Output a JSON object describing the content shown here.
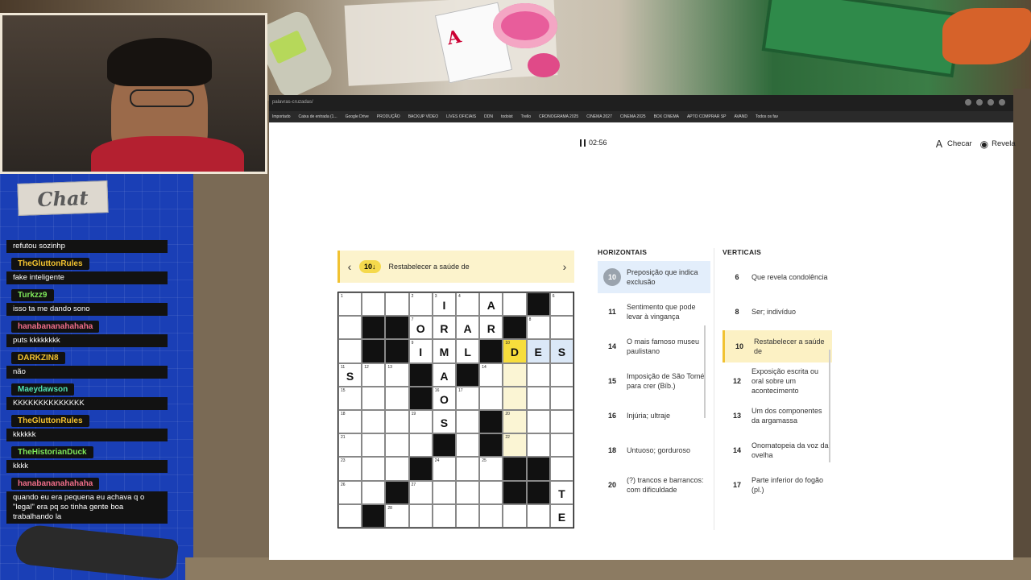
{
  "browser": {
    "url": "palavras-cruzadas/",
    "bookmarks": [
      "Importado",
      "Caixa de entrada (1...",
      "Google Drive",
      "PRODUÇÃO",
      "BACKUP VÍDEO",
      "LIVES OFICIAIS",
      "DDN",
      "todoist",
      "Trello",
      "CRONOGRAMA 2025",
      "CINEMA 2027",
      "CINEMA 2025",
      "BOX CINEMA",
      "APTO COMPRAR SP",
      "AVAND",
      "Todos os fav"
    ]
  },
  "game": {
    "timer": "02:56",
    "check_label": "Checar",
    "reveal_label": "Revela",
    "current_clue": {
      "number": "10↓",
      "text": "Restabelecer a saúde de"
    }
  },
  "grid": {
    "size": 10,
    "blacks": [
      [
        0,
        8
      ],
      [
        1,
        1
      ],
      [
        1,
        2
      ],
      [
        1,
        7
      ],
      [
        2,
        1
      ],
      [
        2,
        2
      ],
      [
        2,
        6
      ],
      [
        3,
        3
      ],
      [
        3,
        5
      ],
      [
        4,
        3
      ],
      [
        5,
        6
      ],
      [
        6,
        4
      ],
      [
        6,
        6
      ],
      [
        7,
        3
      ],
      [
        7,
        7
      ],
      [
        7,
        8
      ],
      [
        8,
        2
      ],
      [
        8,
        7
      ],
      [
        8,
        8
      ],
      [
        9,
        1
      ]
    ],
    "numbers": {
      "0,0": "1",
      "0,3": "2",
      "0,4": "3",
      "0,5": "4",
      "0,9": "6",
      "1,3": "7",
      "1,8": "8",
      "2,3": "9",
      "2,7": "10",
      "3,0": "11",
      "3,1": "12",
      "3,2": "13",
      "3,6": "14",
      "4,0": "15",
      "4,4": "16",
      "4,5": "17",
      "5,0": "18",
      "5,3": "19",
      "5,7": "20",
      "6,0": "21",
      "6,7": "22",
      "7,0": "23",
      "7,4": "24",
      "7,6": "25",
      "8,0": "26",
      "8,3": "27",
      "9,2": "28"
    },
    "letters": {
      "0,4": "I",
      "0,6": "A",
      "1,3": "O",
      "1,4": "R",
      "1,5": "A",
      "1,6": "R",
      "2,3": "I",
      "2,4": "M",
      "2,5": "L",
      "2,7": "D",
      "2,8": "E",
      "2,9": "S",
      "3,0": "S",
      "3,4": "A",
      "4,4": "O",
      "5,4": "S",
      "8,9": "T",
      "9,9": "E"
    },
    "current_cell": [
      2,
      7
    ],
    "highlight_word": [
      [
        3,
        7
      ],
      [
        4,
        7
      ],
      [
        5,
        7
      ],
      [
        6,
        7
      ]
    ],
    "across_word": [
      [
        2,
        8
      ],
      [
        2,
        9
      ]
    ]
  },
  "clues": {
    "horizontal_heading": "HORIZONTAIS",
    "vertical_heading": "VERTICAIS",
    "horizontal": [
      {
        "n": "10",
        "t": "Preposição que indica exclusão",
        "state": "blue"
      },
      {
        "n": "11",
        "t": "Sentimento que pode levar à vingança"
      },
      {
        "n": "14",
        "t": "O mais famoso museu paulistano"
      },
      {
        "n": "15",
        "t": "Imposição de São Tomé para crer (Bíb.)"
      },
      {
        "n": "16",
        "t": "Injúria; ultraje"
      },
      {
        "n": "18",
        "t": "Untuoso; gorduroso"
      },
      {
        "n": "20",
        "t": "(?) trancos e barrancos: com dificuldade"
      }
    ],
    "vertical": [
      {
        "n": "6",
        "t": "Que revela condolência"
      },
      {
        "n": "8",
        "t": "Ser; indivíduo"
      },
      {
        "n": "10",
        "t": "Restabelecer a saúde de",
        "state": "yellow"
      },
      {
        "n": "12",
        "t": "Exposição escrita ou oral sobre um acontecimento"
      },
      {
        "n": "13",
        "t": "Um dos componentes da argamassa"
      },
      {
        "n": "14",
        "t": "Onomatopeia da voz da ovelha"
      },
      {
        "n": "17",
        "t": "Parte inferior do fogão (pl.)"
      }
    ]
  },
  "chat": {
    "title": "Chat",
    "messages": [
      {
        "user": "",
        "text": "refutou sozinhp",
        "color": "#ffffff"
      },
      {
        "user": "TheGluttonRules",
        "text": "fake inteligente",
        "color": "#f2c230"
      },
      {
        "user": "Turkzz9",
        "text": "isso ta me dando sono",
        "color": "#7fe85a"
      },
      {
        "user": "hanabananahahaha",
        "text": "puts kkkkkkkk",
        "color": "#f06e8a"
      },
      {
        "user": "DARKZIN8",
        "text": "não",
        "color": "#f2c230"
      },
      {
        "user": "Maeydawson",
        "text": "KKKKKKKKKKKKKK",
        "color": "#4fe0b0"
      },
      {
        "user": "TheGluttonRules",
        "text": "kkkkkk",
        "color": "#f2c230"
      },
      {
        "user": "TheHistorianDuck",
        "text": "kkkk",
        "color": "#7fe85a"
      },
      {
        "user": "hanabananahahaha",
        "text": "quando eu era pequena eu achava q o \"legal\" era pq so tinha gente boa trabalhando la",
        "color": "#f06e8a"
      }
    ]
  }
}
